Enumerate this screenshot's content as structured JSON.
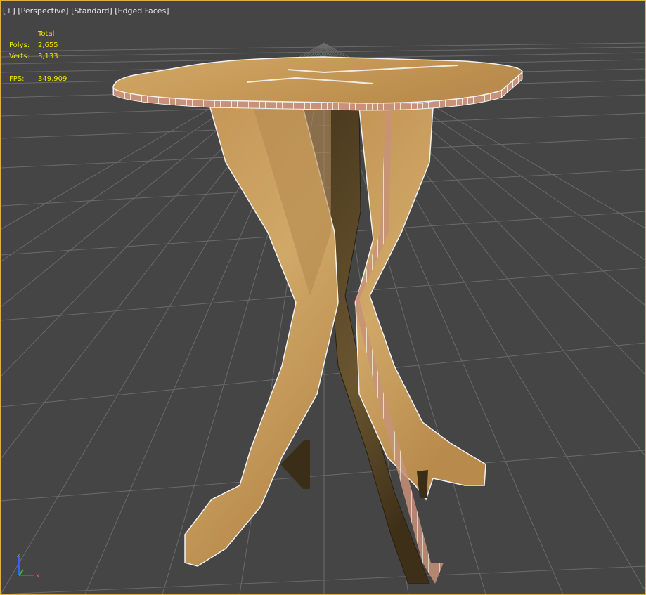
{
  "viewport": {
    "plus_menu": "[+]",
    "view_menu": "[Perspective]",
    "shading_menu": "[Standard]",
    "display_menu": "[Edged Faces]"
  },
  "stats": {
    "header": "Total",
    "polys_label": "Polys:",
    "polys_value": "2,655",
    "verts_label": "Verts:",
    "verts_value": "3,133",
    "fps_label": "FPS:",
    "fps_value": "349,909"
  },
  "gizmo": {
    "z": "z",
    "x": "x"
  },
  "colors": {
    "background": "#454545",
    "grid": "#6a6a6a",
    "stats_text": "#f2e600",
    "viewport_border": "#e0b040",
    "wood": "#c9a063"
  }
}
